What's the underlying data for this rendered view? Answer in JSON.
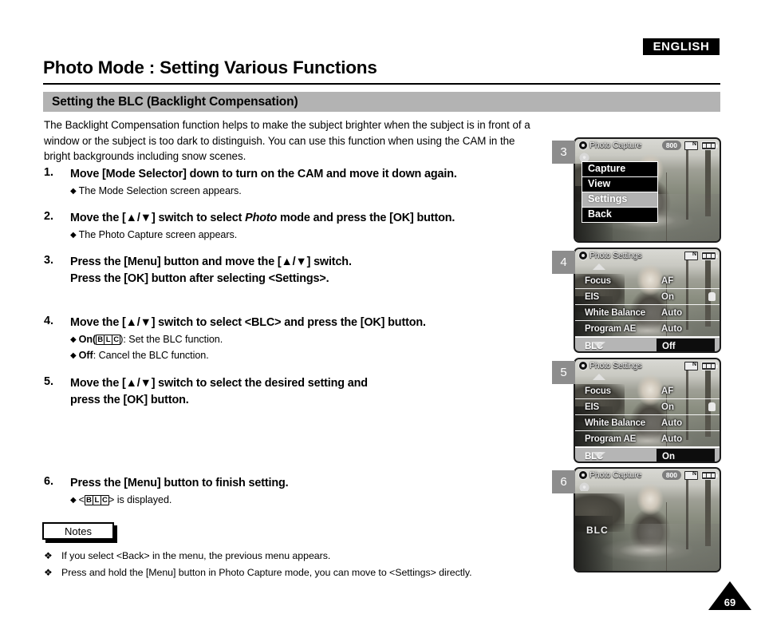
{
  "header": {
    "language_badge": "ENGLISH",
    "page_title": "Photo Mode : Setting Various Functions",
    "section_title": "Setting the BLC (Backlight Compensation)"
  },
  "intro": "The Backlight Compensation function helps to make the subject brighter when the subject is in front of a window or the subject is too dark to distinguish. You can use this function when using the CAM in the bright backgrounds including snow scenes.",
  "steps": [
    {
      "number": "1.",
      "lines": [
        "Move [Mode Selector] down to turn on the CAM and move it down again."
      ],
      "bullets": [
        "The Mode Selection screen appears."
      ]
    },
    {
      "number": "2.",
      "lines": [
        "Move the [▲/▼] switch to select Photo mode and press the [OK] button."
      ],
      "italic_word": "Photo",
      "bullets": [
        "The Photo Capture screen appears."
      ]
    },
    {
      "number": "3.",
      "lines": [
        "Press the [Menu] button and move the [▲/▼] switch.",
        "Press the [OK] button after selecting <Settings>."
      ],
      "bullets": []
    },
    {
      "number": "4.",
      "lines": [
        "Move the [▲/▼] switch to select <BLC> and press the [OK] button."
      ],
      "bullets": [
        "On(BLC): Set the BLC function.",
        "Off: Cancel the BLC function."
      ]
    },
    {
      "number": "5.",
      "lines": [
        "Move the [▲/▼] switch to select the desired setting and",
        "press the [OK] button."
      ],
      "bullets": []
    },
    {
      "number": "6.",
      "lines": [
        "Press the [Menu] button to finish setting."
      ],
      "bullets": [
        "<BLC> is displayed."
      ]
    }
  ],
  "step4_bullet_parts": {
    "on_label": "On(",
    "on_rest": "): Set the BLC function.",
    "off_label": "Off",
    "off_rest": ": Cancel the BLC function."
  },
  "step6_bullet_parts": {
    "pre": "<",
    "post": "> is displayed."
  },
  "blc_glyph": {
    "b": "B",
    "l": "L",
    "c": "C"
  },
  "notes": {
    "tab_label": "Notes",
    "items": [
      "If you select <Back> in the menu, the previous menu appears.",
      "Press and hold the [Menu] button in Photo Capture mode, you can move to <Settings> directly."
    ],
    "marker": "❖"
  },
  "page_number": "69",
  "panels": [
    {
      "badge": "3",
      "screen_title": "Photo Capture",
      "resolution": "800",
      "type": "menu",
      "menu_items": [
        {
          "label": "Capture",
          "selected": false
        },
        {
          "label": "View",
          "selected": false
        },
        {
          "label": "Settings",
          "selected": true
        },
        {
          "label": "Back",
          "selected": false
        }
      ]
    },
    {
      "badge": "4",
      "screen_title": "Photo Settings",
      "resolution": "",
      "type": "settings",
      "rows": [
        {
          "label": "Focus",
          "value": "AF",
          "selected": false
        },
        {
          "label": "EIS",
          "value": "On",
          "selected": false
        },
        {
          "label": "White Balance",
          "value": "Auto",
          "selected": false
        },
        {
          "label": "Program AE",
          "value": "Auto",
          "selected": false
        },
        {
          "label": "BLC",
          "value": "Off",
          "selected": true
        }
      ]
    },
    {
      "badge": "5",
      "screen_title": "Photo Settings",
      "resolution": "",
      "type": "settings",
      "rows": [
        {
          "label": "Focus",
          "value": "AF",
          "selected": false
        },
        {
          "label": "EIS",
          "value": "On",
          "selected": false
        },
        {
          "label": "White Balance",
          "value": "Auto",
          "selected": false
        },
        {
          "label": "Program AE",
          "value": "Auto",
          "selected": false
        },
        {
          "label": "BLC",
          "value": "On",
          "selected": true
        }
      ]
    },
    {
      "badge": "6",
      "screen_title": "Photo Capture",
      "resolution": "800",
      "type": "capture",
      "overlay_indicator": "BLC"
    }
  ],
  "colors": {
    "banner_gray": "#b3b3b3",
    "badge_gray": "#8d8d8d",
    "highlight_gray": "#b5b5b5",
    "black": "#000000"
  }
}
